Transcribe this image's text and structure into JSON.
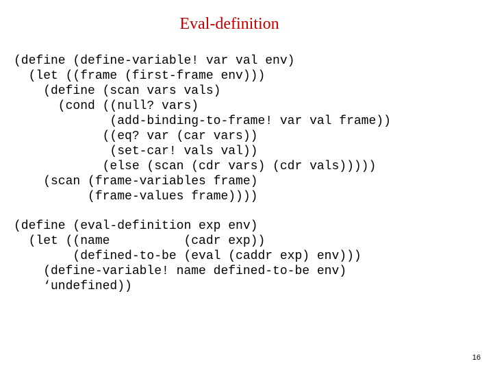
{
  "title": "Eval-definition",
  "code": "(define (define-variable! var val env)\n  (let ((frame (first-frame env)))\n    (define (scan vars vals)\n      (cond ((null? vars)\n             (add-binding-to-frame! var val frame))\n            ((eq? var (car vars))\n             (set-car! vals val))\n            (else (scan (cdr vars) (cdr vals)))))\n    (scan (frame-variables frame)\n          (frame-values frame))))\n\n(define (eval-definition exp env)\n  (let ((name          (cadr exp))\n        (defined-to-be (eval (caddr exp) env)))\n    (define-variable! name defined-to-be env)\n    ‘undefined))",
  "page_number": "16"
}
